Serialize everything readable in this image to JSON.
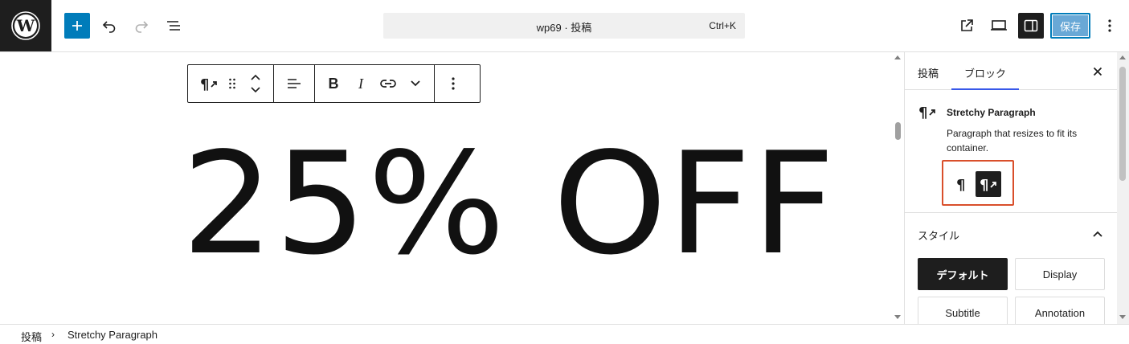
{
  "header": {
    "logo": "wordpress-icon",
    "add_block_icon": "plus-icon",
    "undo_icon": "undo-icon",
    "redo_icon": "redo-icon",
    "list_view_icon": "list-view-icon",
    "command_title": "wp69 · 投稿",
    "command_shortcut": "Ctrl+K",
    "view_post_icon": "external-link-icon",
    "preview_icon": "desktop-icon",
    "settings_icon": "sidebar-icon",
    "save_label": "保存",
    "options_icon": "more-vertical-icon",
    "accent_color": "#007cba"
  },
  "block_toolbar": {
    "icons": [
      "stretchy-paragraph-icon",
      "drag-handle-icon",
      "chevron-up-icon",
      "chevron-down-icon",
      "align-left-icon",
      "bold-icon",
      "italic-icon",
      "link-icon",
      "more-formatting-icon",
      "block-options-icon"
    ],
    "bold_label": "B",
    "italic_label": "I"
  },
  "canvas": {
    "content_text": "25% OFF"
  },
  "sidebar": {
    "tab_post": "投稿",
    "tab_block": "ブロック",
    "close_icon": "close-icon",
    "block_name": "Stretchy Paragraph",
    "block_description": "Paragraph that resizes to fit its container.",
    "variations": [
      {
        "name": "paragraph",
        "icon": "paragraph-icon",
        "active": false
      },
      {
        "name": "stretchy-paragraph",
        "icon": "stretchy-paragraph-icon",
        "active": true
      }
    ],
    "styles_heading": "スタイル",
    "styles": [
      {
        "label": "デフォルト",
        "active": true
      },
      {
        "label": "Display",
        "active": false
      },
      {
        "label": "Subtitle",
        "active": false
      },
      {
        "label": "Annotation",
        "active": false
      }
    ],
    "highlight_color": "#d94f2b"
  },
  "breadcrumb": {
    "root": "投稿",
    "separator": "›",
    "current": "Stretchy Paragraph"
  }
}
